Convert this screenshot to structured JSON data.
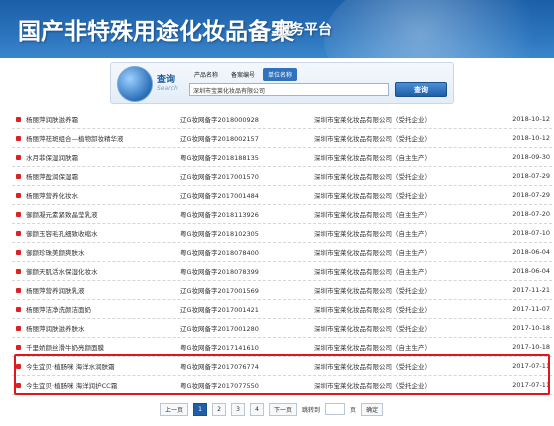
{
  "header": {
    "title": "国产非特殊用途化妆品备案",
    "subtitle": "服务平台"
  },
  "search": {
    "logo_text": "查询",
    "logo_sub": "Search",
    "tabs": [
      {
        "label": "产品名称",
        "active": false
      },
      {
        "label": "备案编号",
        "active": false
      },
      {
        "label": "单位名称",
        "active": true
      }
    ],
    "input_value": "深圳市宝莱化妆品有限公司",
    "button_label": "查询"
  },
  "records": [
    {
      "name": "杨丽萍润肤滋养霜",
      "code": "辽G妆网备字2018000928",
      "company": "深圳市宝莱化妆品有限公司（受托企业）",
      "date": "2018-10-12"
    },
    {
      "name": "杨丽萍祛斑组合—植物卸妆精华液",
      "code": "辽G妆网备字2018002157",
      "company": "深圳市宝莱化妆品有限公司（受托企业）",
      "date": "2018-10-12"
    },
    {
      "name": "水月菲保湿润肤霜",
      "code": "粤G妆网备字2018188135",
      "company": "深圳市宝莱化妆品有限公司（自主生产）",
      "date": "2018-09-30"
    },
    {
      "name": "杨丽萍盈润保湿霜",
      "code": "辽G妆网备字2017001570",
      "company": "深圳市宝莱化妆品有限公司（受托企业）",
      "date": "2018-07-29"
    },
    {
      "name": "杨丽萍营养化妆水",
      "code": "辽G妆网备字2017001484",
      "company": "深圳市宝莱化妆品有限公司（受托企业）",
      "date": "2018-07-29"
    },
    {
      "name": "御颜凝元素紧致晶莹乳液",
      "code": "粤G妆网备字2018113926",
      "company": "深圳市宝莱化妆品有限公司（自主生产）",
      "date": "2018-07-20"
    },
    {
      "name": "御颜玉容毛孔细致收缩水",
      "code": "粤G妆网备字2018102305",
      "company": "深圳市宝莱化妆品有限公司（自主生产）",
      "date": "2018-07-10"
    },
    {
      "name": "御颜珍珠美颜爽肤水",
      "code": "粤G妆网备字2018078400",
      "company": "深圳市宝莱化妆品有限公司（自主生产）",
      "date": "2018-06-04"
    },
    {
      "name": "御颜天肌活水保湿化妆水",
      "code": "粤G妆网备字2018078399",
      "company": "深圳市宝莱化妆品有限公司（自主生产）",
      "date": "2018-06-04"
    },
    {
      "name": "杨丽萍营养润肤乳液",
      "code": "辽G妆网备字2017001569",
      "company": "深圳市宝莱化妆品有限公司（受托企业）",
      "date": "2017-11-21"
    },
    {
      "name": "杨丽萍洁净洗颜洁面奶",
      "code": "辽G妆网备字2017001421",
      "company": "深圳市宝莱化妆品有限公司（受托企业）",
      "date": "2017-11-07"
    },
    {
      "name": "杨丽萍润肤滋养肤水",
      "code": "辽G妆网备字2017001280",
      "company": "深圳市宝莱化妆品有限公司（受托企业）",
      "date": "2017-10-18"
    },
    {
      "name": "千里娇颜丝滑牛奶亮颜面膜",
      "code": "粤G妆网备字2017141610",
      "company": "深圳市宝莱化妆品有限公司（自主生产）",
      "date": "2017-10-18"
    },
    {
      "name": "今生宜贝·植肠咪 海洋水润肤霜",
      "code": "粤G妆网备字2017076774",
      "company": "深圳市宝莱化妆品有限公司（受托企业）",
      "date": "2017-07-11"
    },
    {
      "name": "今生宜贝·植肠咪 海洋润护CC霜",
      "code": "粤G妆网备字2017077550",
      "company": "深圳市宝莱化妆品有限公司（受托企业）",
      "date": "2017-07-11"
    }
  ],
  "pagination": {
    "prev": "上一页",
    "pages": [
      "1",
      "2",
      "3",
      "4"
    ],
    "current": "1",
    "next": "下一页",
    "jump_label": "跳转到",
    "page_unit": "页",
    "confirm": "确定"
  },
  "colors": {
    "header_blue": "#1b5fa8",
    "highlight_red": "#e0161c",
    "bullet_red": "#dd2222"
  }
}
